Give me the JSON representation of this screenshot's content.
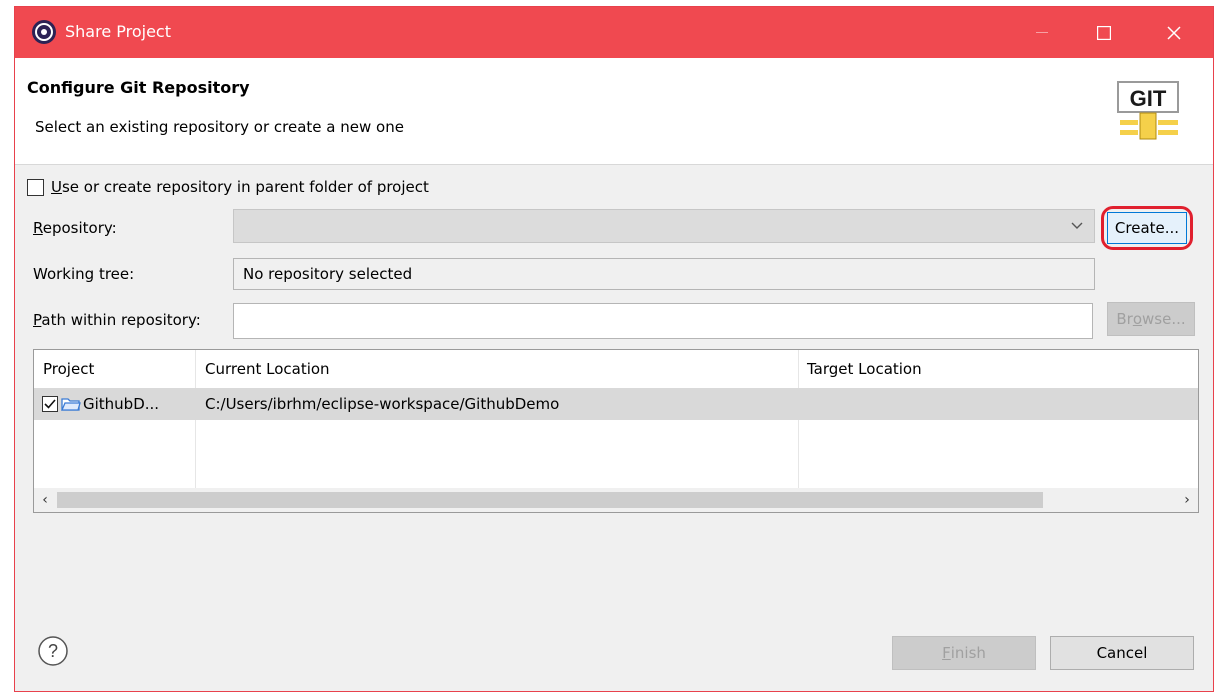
{
  "titlebar": {
    "title": "Share Project",
    "minimize_icon": "minimize-icon",
    "maximize_icon": "maximize-icon",
    "close_icon": "close-icon"
  },
  "header": {
    "title": "Configure Git Repository",
    "description": "Select an existing repository or create a new one",
    "logo_text": "GIT"
  },
  "form": {
    "parent_checkbox": {
      "label_u": "U",
      "label_rest": "se or create repository in parent folder of project",
      "checked": false
    },
    "repository": {
      "label_u": "R",
      "label_rest": "epository:",
      "value": "",
      "create_button": "Create..."
    },
    "working_tree": {
      "label": "Working tree:",
      "value": "No repository selected"
    },
    "path": {
      "label_u": "P",
      "label_rest": "ath within repository:",
      "value": "",
      "browse_pre": "Br",
      "browse_u": "o",
      "browse_post": "wse..."
    }
  },
  "table": {
    "columns": [
      "Project",
      "Current Location",
      "Target Location"
    ],
    "rows": [
      {
        "checked": true,
        "project": "GithubD...",
        "current": "C:/Users/ibrhm/eclipse-workspace/GithubDemo",
        "target": ""
      }
    ]
  },
  "footer": {
    "finish_u": "F",
    "finish_rest": "inish",
    "cancel": "Cancel"
  },
  "colors": {
    "titlebar": "#f04950",
    "annotation": "#e0202e"
  }
}
